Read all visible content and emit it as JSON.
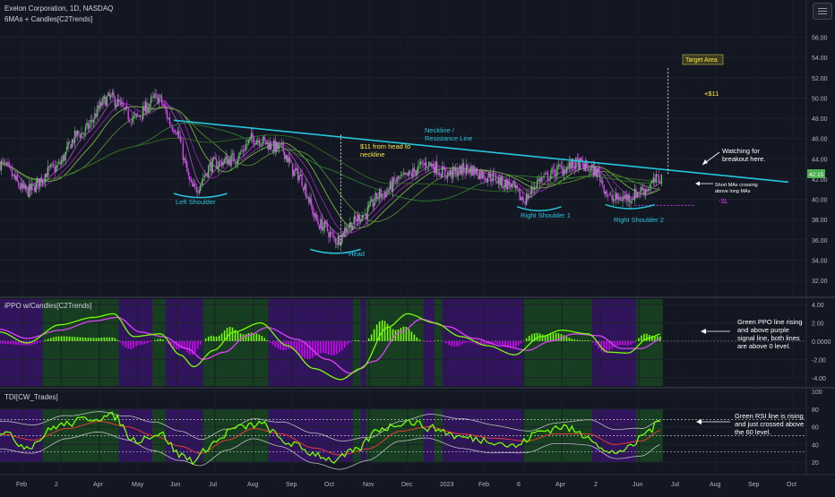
{
  "header": {
    "title": "Exelon Corporation, 1D, NASDAQ",
    "indicator": "6MAs + Candles[C2Trends]"
  },
  "panels": {
    "ppo_title": "iPPO w/Candles[C2Trends]",
    "tdi_title": "TDI[CW_Trades]"
  },
  "annotations": {
    "target_area": "Target Area",
    "plus11": "+$11",
    "neckline_1": "Neckline /",
    "neckline_2": "Resistance Line",
    "head_to_neckline_1": "$11 from head to",
    "head_to_neckline_2": "neckline",
    "watching_1": "Watching for",
    "watching_2": "breakout here.",
    "short_mas_1": "Short MAs crossing",
    "short_mas_2": "above long MAs",
    "minus_sl": "-SL",
    "left_shoulder": "Left Shoulder",
    "head": "Head",
    "right_shoulder_1": "Right Shoulder 1",
    "right_shoulder_2": "Right Shoulder 2",
    "ppo_note": [
      "Green PPO line rising",
      "and above purple",
      "signal line, both lines",
      "are above 0 level."
    ],
    "tdi_note": [
      "Green RSI line is rising",
      "and just crossed above",
      "the 60 level."
    ]
  },
  "price_label": "42.15",
  "colors": {
    "background": "#131722",
    "neckline": "#26c6da",
    "bull_candle": "#66bb6a",
    "bear_candle": "#e040fb",
    "annotation_text": "#ffeb3b",
    "green_zone": "#1b5e20",
    "purple_zone": "#4a148c"
  },
  "chart_data": [
    {
      "type": "candlestick",
      "title": "Exelon Corporation, 1D, NASDAQ",
      "yaxis_ticks": [
        "56.00",
        "54.00",
        "52.00",
        "50.00",
        "48.00",
        "46.00",
        "44.00",
        "42.00",
        "40.00",
        "38.00",
        "36.00",
        "34.00",
        "32.00"
      ],
      "ylim": [
        30.5,
        57.2
      ],
      "x_ticks": [
        "Feb",
        "2",
        "Apr",
        "May",
        "Jun",
        "Jul",
        "Aug",
        "Sep",
        "Oct",
        "Nov",
        "Dec",
        "2023",
        "Feb",
        "6",
        "Apr",
        "2",
        "Jun",
        "Jul",
        "Aug",
        "Sep",
        "Oct"
      ],
      "price_anchors": [
        {
          "t": 0,
          "price": 43.5
        },
        {
          "t": 20,
          "price": 40.8
        },
        {
          "t": 40,
          "price": 43.0
        },
        {
          "t": 60,
          "price": 46.5
        },
        {
          "t": 82,
          "price": 50.0
        },
        {
          "t": 100,
          "price": 48.0
        },
        {
          "t": 118,
          "price": 50.0
        },
        {
          "t": 130,
          "price": 47.2
        },
        {
          "t": 145,
          "price": 41.0
        },
        {
          "t": 160,
          "price": 43.5
        },
        {
          "t": 175,
          "price": 44.0
        },
        {
          "t": 190,
          "price": 46.0
        },
        {
          "t": 210,
          "price": 45.0
        },
        {
          "t": 222,
          "price": 42.5
        },
        {
          "t": 240,
          "price": 37.5
        },
        {
          "t": 252,
          "price": 36.0
        },
        {
          "t": 262,
          "price": 37.5
        },
        {
          "t": 272,
          "price": 38.5
        },
        {
          "t": 285,
          "price": 40.5
        },
        {
          "t": 300,
          "price": 42.0
        },
        {
          "t": 320,
          "price": 43.5
        },
        {
          "t": 335,
          "price": 42.5
        },
        {
          "t": 350,
          "price": 43.0
        },
        {
          "t": 365,
          "price": 42.3
        },
        {
          "t": 380,
          "price": 41.5
        },
        {
          "t": 392,
          "price": 40.0
        },
        {
          "t": 405,
          "price": 42.0
        },
        {
          "t": 420,
          "price": 43.0
        },
        {
          "t": 432,
          "price": 43.5
        },
        {
          "t": 445,
          "price": 42.8
        },
        {
          "t": 458,
          "price": 40.0
        },
        {
          "t": 470,
          "price": 40.2
        },
        {
          "t": 482,
          "price": 41.0
        },
        {
          "t": 495,
          "price": 42.15
        }
      ],
      "neckline": [
        {
          "t": 130,
          "price": 47.8
        },
        {
          "t": 590,
          "price": 41.7
        }
      ],
      "target_line": {
        "t": 500,
        "from": 42.5,
        "to": 53.0
      },
      "head_line": {
        "t": 255,
        "from": 35.6,
        "to": 46.5
      },
      "stop_loss_level": 39.4,
      "last_price": 42.15
    },
    {
      "type": "line",
      "title": "iPPO w/Candles[C2Trends]",
      "yaxis_ticks": [
        "4.00",
        "2.00",
        "0.0000",
        "-2.00",
        "-4.00"
      ],
      "ylim": [
        -4.9,
        4.6
      ],
      "series": [
        {
          "name": "PPO",
          "anchors": [
            [
              0,
              1.0
            ],
            [
              20,
              -0.2
            ],
            [
              45,
              1.8
            ],
            [
              70,
              2.6
            ],
            [
              85,
              3.0
            ],
            [
              100,
              0.5
            ],
            [
              120,
              0.8
            ],
            [
              135,
              -1.5
            ],
            [
              145,
              -2.8
            ],
            [
              160,
              -1.0
            ],
            [
              175,
              1.0
            ],
            [
              195,
              2.0
            ],
            [
              215,
              -0.5
            ],
            [
              235,
              -3.0
            ],
            [
              255,
              -4.2
            ],
            [
              270,
              -3.0
            ],
            [
              290,
              1.5
            ],
            [
              305,
              3.0
            ],
            [
              325,
              2.0
            ],
            [
              345,
              0.5
            ],
            [
              365,
              -0.5
            ],
            [
              385,
              -1.5
            ],
            [
              405,
              0.5
            ],
            [
              420,
              1.2
            ],
            [
              440,
              0.8
            ],
            [
              455,
              -1.2
            ],
            [
              470,
              -1.3
            ],
            [
              485,
              0.3
            ],
            [
              495,
              0.8
            ]
          ]
        },
        {
          "name": "Signal",
          "anchors": [
            [
              0,
              1.3
            ],
            [
              20,
              0.3
            ],
            [
              45,
              1.2
            ],
            [
              70,
              2.2
            ],
            [
              88,
              2.6
            ],
            [
              105,
              1.0
            ],
            [
              122,
              0.5
            ],
            [
              140,
              -0.8
            ],
            [
              152,
              -2.0
            ],
            [
              168,
              -1.2
            ],
            [
              185,
              0.6
            ],
            [
              200,
              1.5
            ],
            [
              222,
              0.2
            ],
            [
              245,
              -2.0
            ],
            [
              262,
              -3.5
            ],
            [
              280,
              -2.2
            ],
            [
              300,
              1.0
            ],
            [
              315,
              2.4
            ],
            [
              335,
              1.6
            ],
            [
              355,
              0.3
            ],
            [
              375,
              -0.5
            ],
            [
              395,
              -1.0
            ],
            [
              412,
              0.0
            ],
            [
              430,
              0.8
            ],
            [
              448,
              0.6
            ],
            [
              465,
              -0.8
            ],
            [
              480,
              -0.8
            ],
            [
              495,
              0.2
            ]
          ]
        }
      ]
    },
    {
      "type": "line",
      "title": "TDI[CW_Trades]",
      "yaxis_ticks": [
        "100",
        "80",
        "60",
        "40",
        "20"
      ],
      "ylim": [
        8,
        102
      ],
      "levels": [
        32,
        50,
        68
      ],
      "series": [
        {
          "name": "RSI",
          "anchors": [
            [
              0,
              55
            ],
            [
              20,
              38
            ],
            [
              45,
              62
            ],
            [
              70,
              70
            ],
            [
              85,
              72
            ],
            [
              100,
              45
            ],
            [
              120,
              52
            ],
            [
              135,
              28
            ],
            [
              145,
              22
            ],
            [
              160,
              42
            ],
            [
              175,
              58
            ],
            [
              195,
              63
            ],
            [
              215,
              42
            ],
            [
              235,
              30
            ],
            [
              250,
              22
            ],
            [
              265,
              32
            ],
            [
              285,
              58
            ],
            [
              305,
              66
            ],
            [
              325,
              58
            ],
            [
              345,
              48
            ],
            [
              365,
              45
            ],
            [
              385,
              38
            ],
            [
              405,
              55
            ],
            [
              420,
              60
            ],
            [
              440,
              50
            ],
            [
              455,
              30
            ],
            [
              470,
              35
            ],
            [
              485,
              55
            ],
            [
              495,
              67
            ]
          ]
        },
        {
          "name": "Signal",
          "anchors": [
            [
              0,
              52
            ],
            [
              25,
              45
            ],
            [
              50,
              58
            ],
            [
              75,
              66
            ],
            [
              95,
              60
            ],
            [
              115,
              50
            ],
            [
              135,
              38
            ],
            [
              150,
              30
            ],
            [
              170,
              45
            ],
            [
              190,
              58
            ],
            [
              210,
              52
            ],
            [
              235,
              36
            ],
            [
              255,
              28
            ],
            [
              275,
              35
            ],
            [
              300,
              55
            ],
            [
              320,
              60
            ],
            [
              345,
              52
            ],
            [
              370,
              47
            ],
            [
              395,
              44
            ],
            [
              415,
              52
            ],
            [
              440,
              52
            ],
            [
              460,
              40
            ],
            [
              480,
              44
            ],
            [
              495,
              56
            ]
          ]
        }
      ]
    }
  ],
  "x_tick_positions_note": "evenly along time axis"
}
